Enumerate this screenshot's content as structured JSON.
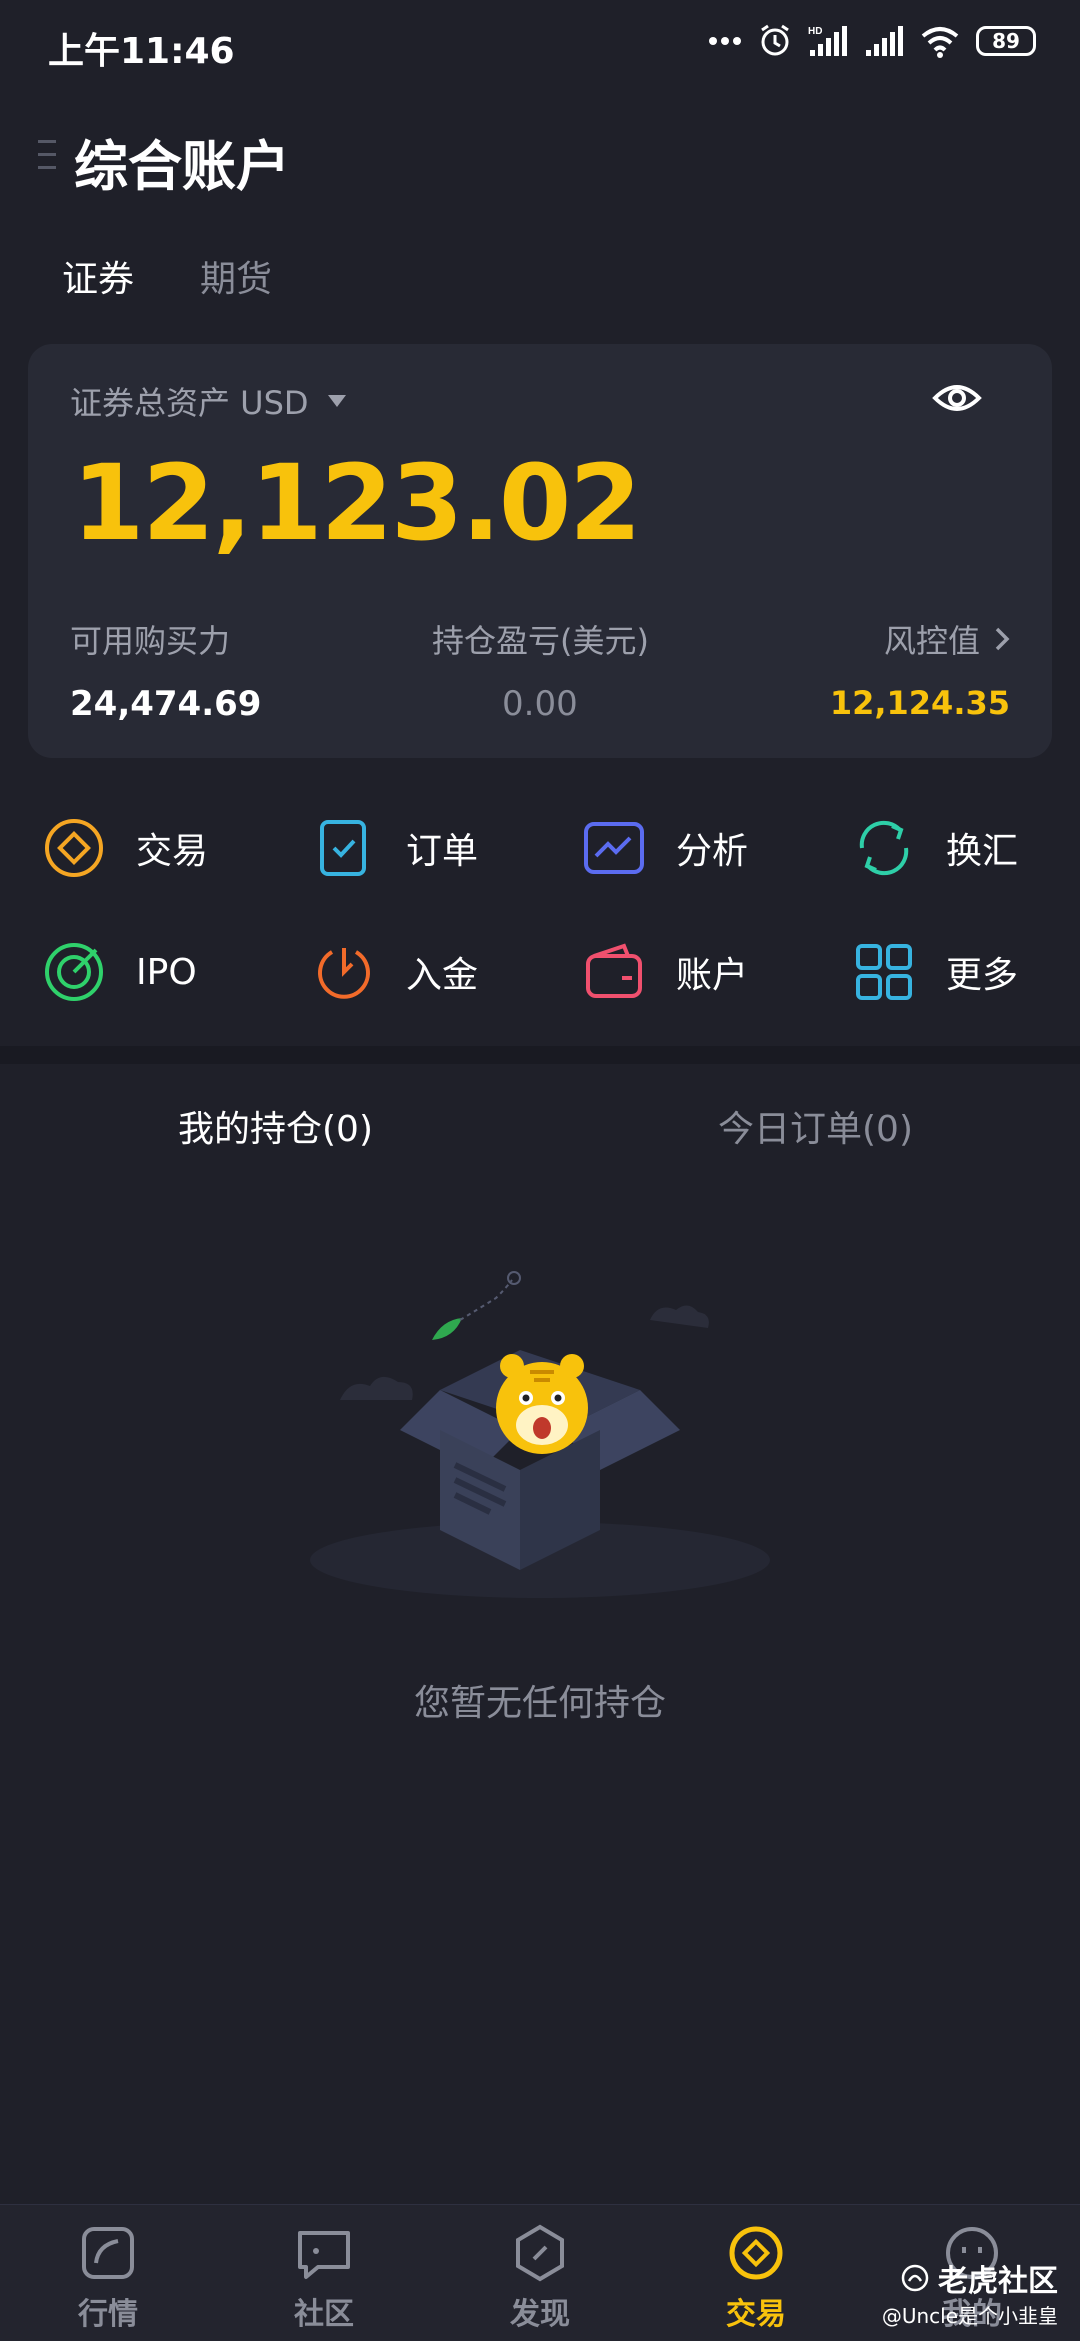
{
  "status_bar": {
    "time": "上午11:46",
    "battery": "89"
  },
  "header": {
    "title": "综合账户"
  },
  "top_tabs": [
    {
      "label": "证券",
      "active": true
    },
    {
      "label": "期货",
      "active": false
    }
  ],
  "asset_card": {
    "label": "证券总资产 USD",
    "total": "12,123.02",
    "buying_power_label": "可用购买力",
    "buying_power_value": "24,474.69",
    "pnl_label": "持仓盈亏(美元)",
    "pnl_value": "0.00",
    "risk_label": "风控值",
    "risk_value": "12,124.35"
  },
  "shortcuts": [
    {
      "label": "交易",
      "icon": "trade-icon",
      "color": "#f5a623"
    },
    {
      "label": "订单",
      "icon": "order-icon",
      "color": "#37b3e0"
    },
    {
      "label": "分析",
      "icon": "analysis-icon",
      "color": "#5b6cf0"
    },
    {
      "label": "换汇",
      "icon": "exchange-icon",
      "color": "#2ecfa8"
    },
    {
      "label": "IPO",
      "icon": "ipo-icon",
      "color": "#2fd16b"
    },
    {
      "label": "入金",
      "icon": "deposit-icon",
      "color": "#f26b2a"
    },
    {
      "label": "账户",
      "icon": "account-icon",
      "color": "#f0506e"
    },
    {
      "label": "更多",
      "icon": "more-icon",
      "color": "#37b3e0"
    }
  ],
  "holdings_tabs": [
    {
      "label": "我的持仓(0)",
      "active": true
    },
    {
      "label": "今日订单(0)",
      "active": false
    }
  ],
  "empty_state": {
    "text": "您暂无任何持仓"
  },
  "bottom_nav": [
    {
      "label": "行情",
      "active": false
    },
    {
      "label": "社区",
      "active": false
    },
    {
      "label": "发现",
      "active": false
    },
    {
      "label": "交易",
      "active": true
    },
    {
      "label": "我的",
      "active": false
    }
  ],
  "watermark": {
    "brand": "老虎社区",
    "user": "@Uncle是个小韭皇"
  },
  "colors": {
    "accent": "#f8c20c",
    "background": "#1f2029",
    "card": "#282a35"
  }
}
